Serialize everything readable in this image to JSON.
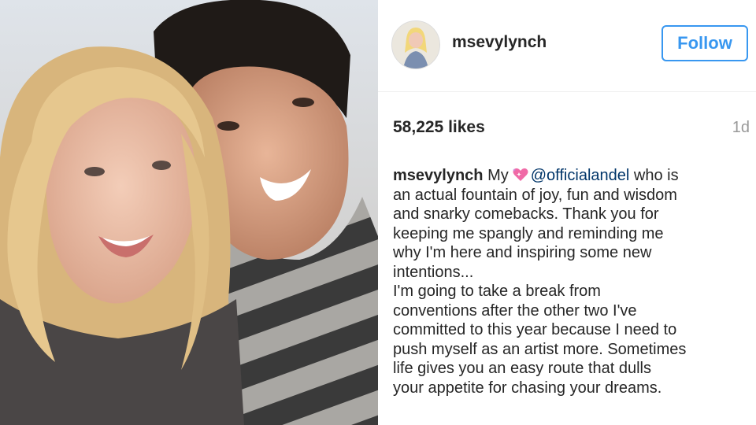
{
  "post": {
    "username": "msevylynch",
    "follow_label": "Follow",
    "likes": "58,225 likes",
    "timestamp": "1d",
    "caption": {
      "username": "msevylynch",
      "prefix": "My",
      "heart_icon": "sparkling-heart-icon",
      "mention": "@officialandel",
      "first_line_rest": "who is",
      "lines": [
        "an actual fountain of joy, fun and wisdom",
        "and snarky comebacks. Thank you for",
        "keeping me spangly and reminding me",
        "why I'm here and inspiring some new",
        "intentions...",
        "I'm going to take a break from",
        "conventions after the other two I've",
        "committed to this year because I need to",
        "push myself as an artist more. Sometimes",
        "life gives you an easy route that dulls",
        "your appetite for chasing your dreams."
      ]
    }
  },
  "colors": {
    "accent": "#3897f0",
    "mention": "#003569",
    "text": "#262626",
    "muted": "#999999"
  }
}
